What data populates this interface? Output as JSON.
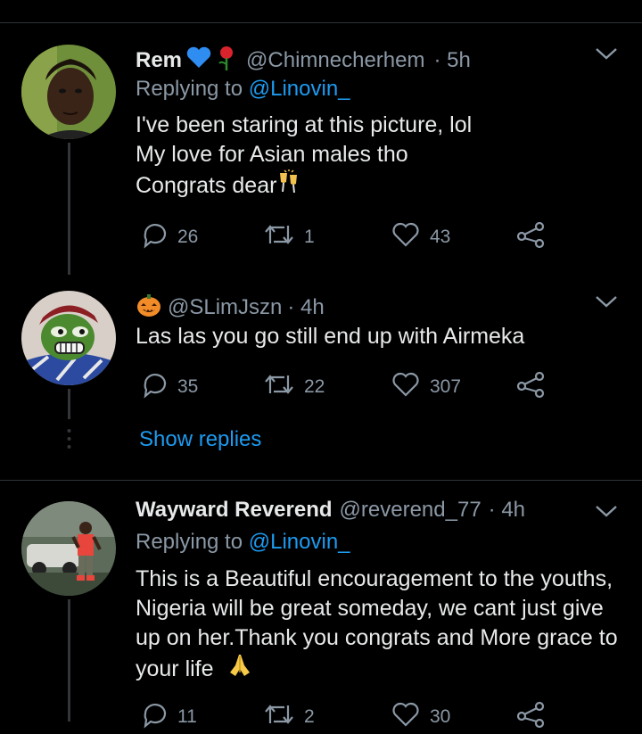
{
  "tweets": [
    {
      "name": "Rem",
      "handle": "@Chimnecherhem",
      "time": "· 5h",
      "replying_prefix": "Replying to ",
      "replying_handle": "@Linovin_",
      "lines": [
        "I've been staring at this picture, lol",
        "My love for Asian males tho",
        "Congrats dear"
      ],
      "replies": "26",
      "retweets": "1",
      "likes": "43"
    },
    {
      "name": "",
      "handle": "@SLimJszn",
      "time": "· 4h",
      "lines": [
        "Las las you go still end up with Airmeka"
      ],
      "replies": "35",
      "retweets": "22",
      "likes": "307"
    },
    {
      "name": "Wayward Reverend",
      "handle": "@reverend_77",
      "time": "· 4h",
      "replying_prefix": "Replying to ",
      "replying_handle": "@Linovin_",
      "lines": [
        "This is a Beautiful encouragement to the youths,",
        "Nigeria will be great someday, we cant just give",
        "up on her.Thank you  congrats and More grace to",
        "your life"
      ],
      "replies": "11",
      "retweets": "2",
      "likes": "30"
    }
  ],
  "show_replies": "Show replies",
  "colors": {
    "background": "#000000",
    "link": "#1d9bf0",
    "muted": "#8b98a5"
  },
  "icons": [
    "reply-icon",
    "retweet-icon",
    "like-icon",
    "share-icon",
    "chevron-down-icon",
    "blue-heart-emoji",
    "rose-emoji",
    "clinking-glasses-emoji",
    "jack-o-lantern-emoji",
    "folded-hands-emoji"
  ]
}
